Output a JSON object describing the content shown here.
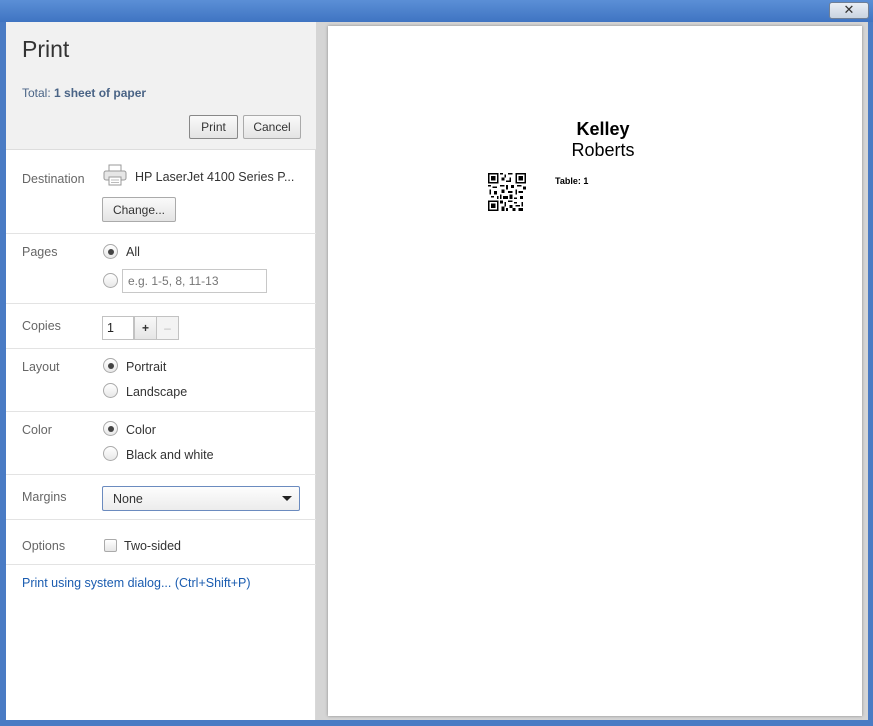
{
  "window": {
    "close_glyph": "✕"
  },
  "header": {
    "title": "Print",
    "total_prefix": "Total: ",
    "total_value": "1 sheet of paper",
    "print_button": "Print",
    "cancel_button": "Cancel"
  },
  "destination": {
    "label": "Destination",
    "printer_name": "HP LaserJet 4100 Series P...",
    "change_button": "Change...",
    "icon": "printer-icon"
  },
  "pages": {
    "label": "Pages",
    "all_label": "All",
    "range_placeholder": "e.g. 1-5, 8, 11-13",
    "selected": "All"
  },
  "copies": {
    "label": "Copies",
    "value": "1",
    "plus": "+",
    "minus": "–"
  },
  "layout": {
    "label": "Layout",
    "portrait_label": "Portrait",
    "landscape_label": "Landscape",
    "selected": "Portrait"
  },
  "color": {
    "label": "Color",
    "color_label": "Color",
    "bw_label": "Black and white",
    "selected": "Color"
  },
  "margins": {
    "label": "Margins",
    "selected_value": "None"
  },
  "options": {
    "label": "Options",
    "two_sided_label": "Two-sided",
    "two_sided_checked": false
  },
  "system_dialog_link": "Print using system dialog... (Ctrl+Shift+P)",
  "preview": {
    "first_name": "Kelley",
    "last_name": "Roberts",
    "table_label": "Table: 1"
  },
  "colors": {
    "accent_link": "#1a5cb0",
    "header_bg": "#f1f1f1",
    "frame": "#4a7bc4"
  }
}
